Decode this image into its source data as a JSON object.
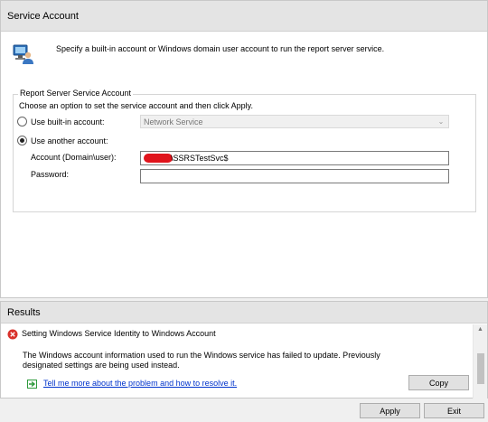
{
  "header": {
    "title": "Service Account"
  },
  "intro": {
    "text": "Specify a built-in account or Windows domain user account to run the report server service.",
    "icon": "computer-user-icon"
  },
  "group": {
    "legend": "Report Server Service Account",
    "instruction": "Choose an option to set the service account and then click Apply.",
    "builtin_label": "Use built-in account:",
    "builtin_value": "Network Service",
    "another_label": "Use another account:",
    "account_label": "Account (Domain\\user):",
    "account_value": "\\SSRSTestSvc$",
    "password_label": "Password:",
    "password_value": ""
  },
  "results": {
    "title": "Results",
    "message_title": "Setting Windows Service Identity to Windows Account",
    "message_body_line1": "The Windows account information used to run the Windows service has failed to update. Previously",
    "message_body_line2": "designated settings are being used instead.",
    "help_link": "Tell me more about the problem and how to resolve it.",
    "copy_label": "Copy"
  },
  "footer": {
    "apply_label": "Apply",
    "exit_label": "Exit"
  },
  "colors": {
    "error": "#d9312b",
    "link": "#0033cc",
    "arrow": "#2e9a3c",
    "redaction": "#e0141c"
  }
}
